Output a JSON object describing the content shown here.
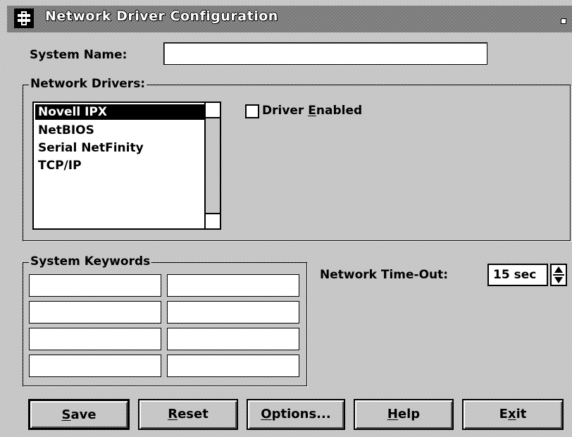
{
  "window": {
    "title": "Network Driver Configuration",
    "titlebar_color": "#000000",
    "icons": [
      "system-menu-icon",
      "minimize-icon"
    ]
  },
  "system_name": {
    "label": "System Name:",
    "value": ""
  },
  "network_drivers": {
    "group_label": "Network Drivers:",
    "items": [
      "Novell IPX",
      "NetBIOS",
      "Serial NetFinity",
      "TCP/IP"
    ],
    "selected": "Novell IPX",
    "checkbox_label_pre": "Driver ",
    "checkbox_label_mn": "E",
    "checkbox_label_post": "nabled",
    "checkbox_checked": false
  },
  "system_keywords": {
    "group_label": "System Keywords",
    "fields": [
      "",
      "",
      "",
      "",
      "",
      "",
      "",
      ""
    ]
  },
  "network_timeout": {
    "label": "Network Time-Out:",
    "value": "15 sec"
  },
  "buttons": {
    "save": {
      "mn": "S",
      "rest": "ave"
    },
    "reset": {
      "mn": "R",
      "rest": "eset"
    },
    "options": {
      "mn": "O",
      "rest": "ptions..."
    },
    "help": {
      "mn": "H",
      "rest": "elp"
    },
    "exit": {
      "pre": "E",
      "mn": "x",
      "rest": "it"
    }
  }
}
